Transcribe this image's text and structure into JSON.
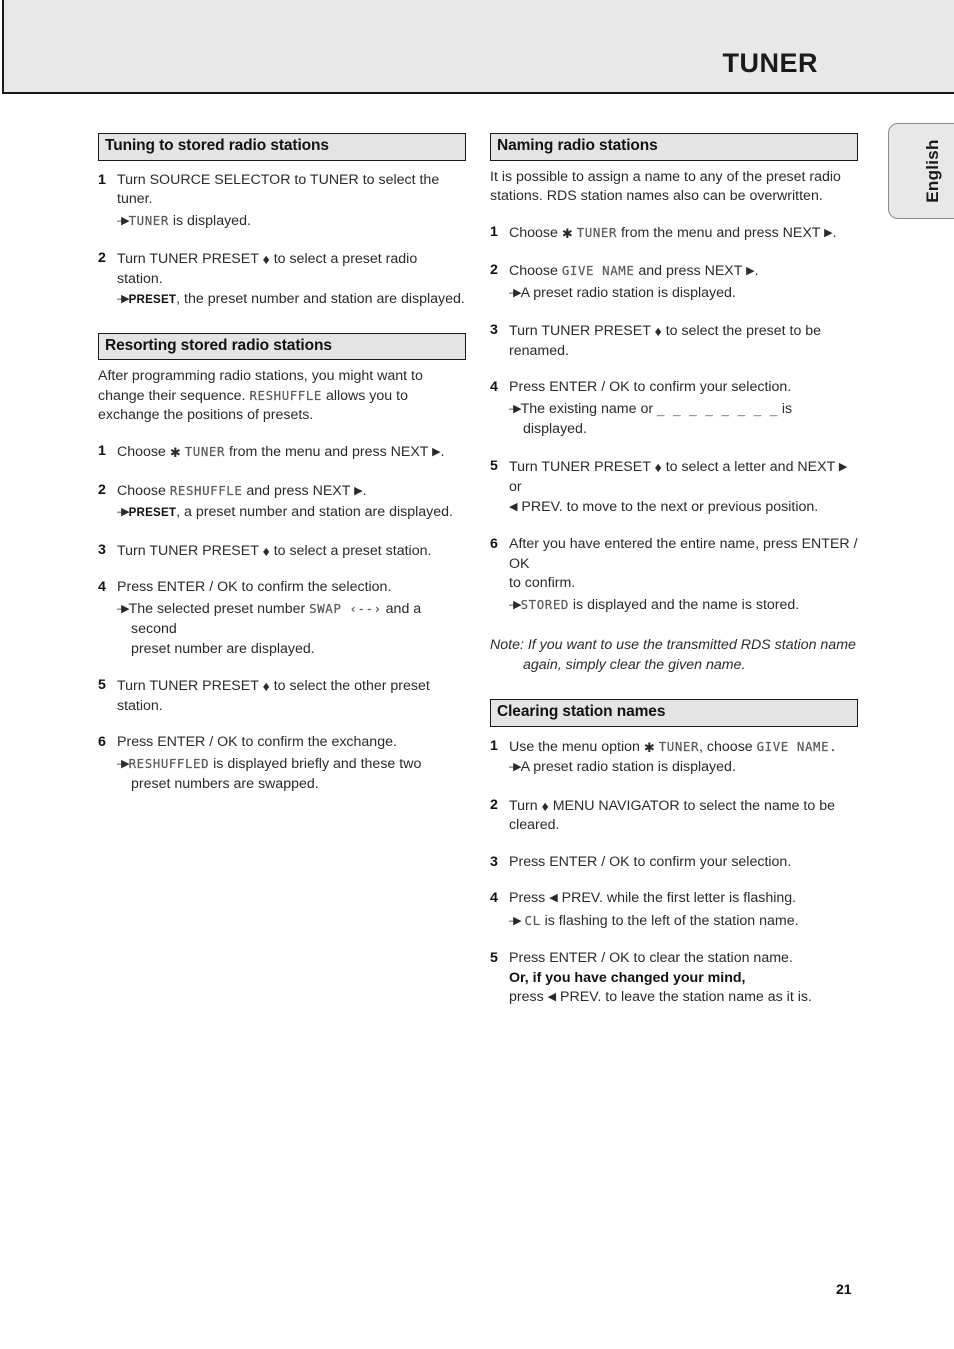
{
  "header": {
    "title": "TUNER"
  },
  "language_tab": {
    "label": "English"
  },
  "page_number": "21",
  "symbols": {
    "updown_arrow": "up-down-arrow",
    "next_triangle": "right-triangle",
    "prev_triangle": "left-triangle",
    "menu_star": "star-asterisk",
    "result_arrow": "arrow-result"
  },
  "left_column": {
    "sections": [
      {
        "heading": "Tuning to stored radio stations",
        "steps": [
          {
            "num": "1",
            "text_a": "Turn SOURCE SELECTOR to TUNER to select the tuner.",
            "result_lcd": "TUNER",
            "result_after": " is displayed."
          },
          {
            "num": "2",
            "text_a": "Turn TUNER PRESET ",
            "text_b": " to select a preset radio station.",
            "result_caps": "PRESET",
            "result_after": ", the preset number and station are displayed."
          }
        ]
      },
      {
        "heading": "Resorting stored radio stations",
        "intro_a": "After programming radio stations, you might want to change their sequence. ",
        "intro_lcd": "RESHUFFLE",
        "intro_b": " allows you to exchange the positions of presets.",
        "steps": [
          {
            "num": "1",
            "text_a": "Choose ",
            "lcd": "TUNER",
            "text_b": " from the menu and press NEXT ",
            "text_c": "."
          },
          {
            "num": "2",
            "text_a": "Choose ",
            "lcd": "RESHUFFLE",
            "text_b": " and press NEXT ",
            "text_c": ".",
            "result_caps": "PRESET",
            "result_after": ", a preset number and station are displayed."
          },
          {
            "num": "3",
            "text_a": "Turn TUNER PRESET ",
            "text_b": " to select a preset station."
          },
          {
            "num": "4",
            "text_a": "Press ENTER / OK to confirm the selection.",
            "result_pre": "The selected preset number ",
            "result_lcd": "SWAP  ‹--›",
            "result_post": " and a second",
            "result_cont": "preset number are displayed."
          },
          {
            "num": "5",
            "text_a": "Turn TUNER PRESET ",
            "text_b": " to select the other preset station."
          },
          {
            "num": "6",
            "text_a": "Press ENTER / OK to confirm the exchange.",
            "result_lcd": "RESHUFFLED",
            "result_after": " is displayed briefly and these two",
            "result_cont": "preset numbers are swapped."
          }
        ]
      }
    ]
  },
  "right_column": {
    "sections": [
      {
        "heading": "Naming radio stations",
        "intro": "It is possible to assign a name to any of the preset radio stations. RDS station names also can be overwritten.",
        "steps": [
          {
            "num": "1",
            "text_a": "Choose ",
            "lcd": "TUNER",
            "text_b": " from the menu and press NEXT ",
            "text_c": "."
          },
          {
            "num": "2",
            "text_a": "Choose ",
            "lcd": "GIVE NAME",
            "text_b": " and press NEXT ",
            "text_c": ".",
            "result_after": "A preset radio station is displayed."
          },
          {
            "num": "3",
            "text_a": "Turn TUNER PRESET ",
            "text_b": " to select the preset to be renamed."
          },
          {
            "num": "4",
            "text_a": "Press ENTER / OK to confirm your selection.",
            "result_pre": "The existing name or ",
            "result_lcd": "_ _ _ _ _ _ _ _",
            "result_post": " is displayed."
          },
          {
            "num": "5",
            "text_a": "Turn TUNER PRESET ",
            "text_b": " to select a letter and NEXT ",
            "text_c": " or",
            "cont_b": " PREV. to move to the next or previous position."
          },
          {
            "num": "6",
            "text_a": "After you have entered the entire name, press ENTER / OK",
            "text_cont": "to confirm.",
            "result_lcd": "STORED",
            "result_after": " is displayed and the name is stored."
          }
        ],
        "note_label": "Note: ",
        "note_text": "If you want to use the transmitted RDS station name",
        "note_cont": "again, simply clear the given name."
      },
      {
        "heading": "Clearing station names",
        "steps": [
          {
            "num": "1",
            "text_a": "Use the menu option ",
            "lcd": "TUNER",
            "text_b": ", choose ",
            "lcd2": "GIVE NAME.",
            "result_after": "A preset radio station is displayed."
          },
          {
            "num": "2",
            "text_a": "Turn ",
            "text_b": " MENU NAVIGATOR to select the name to be",
            "text_cont": "cleared."
          },
          {
            "num": "3",
            "text_a": "Press ENTER / OK to confirm your selection."
          },
          {
            "num": "4",
            "text_a": "Press ",
            "text_b": " PREV. while the first letter is flashing.",
            "result_lcd": "CL",
            "result_after": " is flashing to the left of the station name."
          },
          {
            "num": "5",
            "text_a": "Press ENTER / OK to clear the station name.",
            "bold_line": "Or, if you have changed your mind,",
            "text_c": "press ",
            "text_d": " PREV. to leave the station name as it is."
          }
        ]
      }
    ]
  }
}
